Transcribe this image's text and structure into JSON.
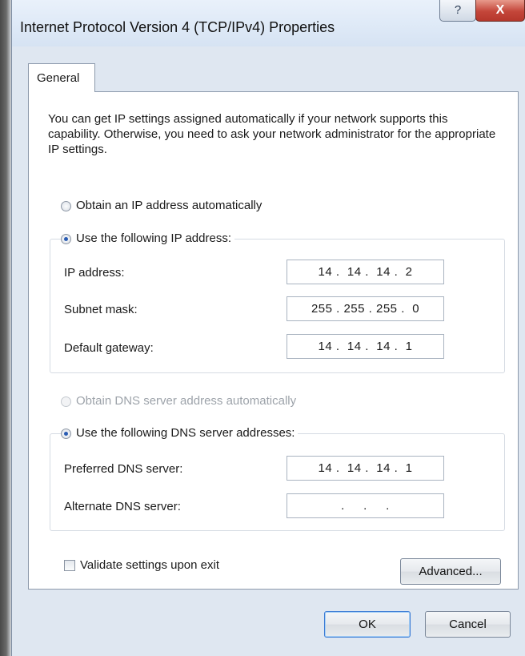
{
  "window": {
    "title": "Internet Protocol Version 4 (TCP/IPv4) Properties",
    "help_glyph": "?",
    "close_glyph": "X"
  },
  "tabs": [
    {
      "label": "General",
      "selected": true
    }
  ],
  "general": {
    "description": "You can get IP settings assigned automatically if your network supports this capability. Otherwise, you need to ask your network administrator for the appropriate IP settings.",
    "ip_auto_label": "Obtain an IP address automatically",
    "ip_manual_label": "Use the following IP address:",
    "ip_mode": "manual",
    "ip_fields": [
      {
        "label": "IP address:",
        "value": "14 .  14 .  14 .  2"
      },
      {
        "label": "Subnet mask:",
        "value": "255 . 255 . 255 .  0"
      },
      {
        "label": "Default gateway:",
        "value": "14 .  14 .  14 .  1"
      }
    ],
    "dns_auto_label": "Obtain DNS server address automatically",
    "dns_manual_label": "Use the following DNS server addresses:",
    "dns_mode": "manual",
    "dns_fields": [
      {
        "label": "Preferred DNS server:",
        "value": "14 .  14 .  14 .  1"
      },
      {
        "label": "Alternate DNS server:",
        "value": "   .     .     .   "
      }
    ],
    "validate_label": "Validate settings upon exit",
    "validate_checked": false,
    "advanced_label": "Advanced..."
  },
  "footer": {
    "ok_label": "OK",
    "cancel_label": "Cancel"
  },
  "colors": {
    "dialog_bg": "#dfe7f1",
    "close_button": "#c4463a",
    "radio_selected": "#2a5cb3"
  }
}
